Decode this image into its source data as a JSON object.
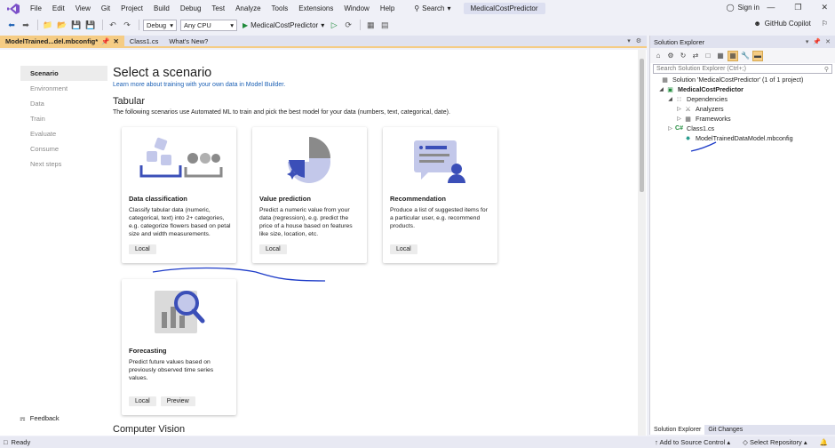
{
  "menubar": {
    "items": [
      "File",
      "Edit",
      "View",
      "Git",
      "Project",
      "Build",
      "Debug",
      "Test",
      "Analyze",
      "Tools",
      "Extensions",
      "Window",
      "Help"
    ],
    "search_label": "Search",
    "solution_name": "MedicalCostPredictor",
    "signin_label": "Sign in"
  },
  "toolbar": {
    "config": "Debug",
    "platform": "Any CPU",
    "run_target": "MedicalCostPredictor",
    "copilot_label": "GitHub Copilot"
  },
  "tabs": [
    {
      "label": "ModelTrained...del.mbconfig*",
      "active": true
    },
    {
      "label": "Class1.cs",
      "active": false
    },
    {
      "label": "What's New?",
      "active": false
    }
  ],
  "steps": [
    "Scenario",
    "Environment",
    "Data",
    "Train",
    "Evaluate",
    "Consume",
    "Next steps"
  ],
  "feedback_label": "Feedback",
  "content": {
    "title": "Select a scenario",
    "learn_link": "Learn more about training with your own data in Model Builder.",
    "tabular_heading": "Tabular",
    "tabular_desc": "The following scenarios use Automated ML to train and pick the best model for your data (numbers, text, categorical, date).",
    "cv_heading": "Computer Vision"
  },
  "cards": [
    {
      "title": "Data classification",
      "desc": "Classify tabular data (numeric, categorical, text) into 2+ categories, e.g. categorize flowers based on petal size and width measurements.",
      "buttons": [
        "Local"
      ]
    },
    {
      "title": "Value prediction",
      "desc": "Predict a numeric value from your data (regression), e.g. predict the price of a house based on features like size, location, etc.",
      "buttons": [
        "Local"
      ]
    },
    {
      "title": "Recommendation",
      "desc": "Produce a list of suggested items for a particular user, e.g. recommend products.",
      "buttons": [
        "Local"
      ]
    },
    {
      "title": "Forecasting",
      "desc": "Predict future values based on previously observed time series values.",
      "buttons": [
        "Local",
        "Preview"
      ]
    }
  ],
  "solution_explorer": {
    "title": "Solution Explorer",
    "search_placeholder": "Search Solution Explorer (Ctrl+;)",
    "tree": [
      {
        "label": "Solution 'MedicalCostPredictor' (1 of 1 project)",
        "icon": "solution-icon"
      },
      {
        "label": "MedicalCostPredictor",
        "icon": "project-icon",
        "bold": true
      },
      {
        "label": "Dependencies",
        "icon": "dependencies-icon"
      },
      {
        "label": "Analyzers",
        "icon": "analyzers-icon"
      },
      {
        "label": "Frameworks",
        "icon": "frameworks-icon"
      },
      {
        "label": "Class1.cs",
        "icon": "csharp-file-icon"
      },
      {
        "label": "ModelTrainedDataModel.mbconfig",
        "icon": "mbconfig-file-icon"
      }
    ],
    "bottom_tabs": [
      "Solution Explorer",
      "Git Changes"
    ]
  },
  "statusbar": {
    "status": "Ready",
    "source_control": "Add to Source Control",
    "repository": "Select Repository"
  },
  "colors": {
    "accent_tab": "#f5cc84",
    "link": "#1a5fb4",
    "illustration_blue": "#3b4fb8",
    "illustration_light": "#c3c8ea",
    "annotation_ink": "#1e3cc8"
  }
}
